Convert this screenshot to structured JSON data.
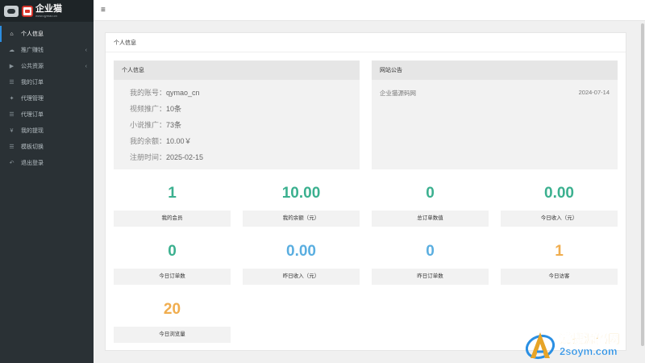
{
  "app": {
    "logo_title": "企业猫",
    "logo_sub": "www.qymao.cn"
  },
  "sidebar": {
    "items": [
      {
        "label": "个人信息",
        "icon": "home-icon",
        "glyph": "⌂",
        "active": true,
        "has_arrow": false
      },
      {
        "label": "推广赚钱",
        "icon": "cloud-icon",
        "glyph": "☁",
        "active": false,
        "has_arrow": true
      },
      {
        "label": "公共资源",
        "icon": "video-icon",
        "glyph": "▶",
        "active": false,
        "has_arrow": true
      },
      {
        "label": "我的订单",
        "icon": "list-icon",
        "glyph": "☰",
        "active": false,
        "has_arrow": false
      },
      {
        "label": "代理管理",
        "icon": "gift-icon",
        "glyph": "✦",
        "active": false,
        "has_arrow": false
      },
      {
        "label": "代理订单",
        "icon": "list-icon",
        "glyph": "☰",
        "active": false,
        "has_arrow": false
      },
      {
        "label": "我的提现",
        "icon": "yen-icon",
        "glyph": "¥",
        "active": false,
        "has_arrow": false
      },
      {
        "label": "模板切换",
        "icon": "list-icon",
        "glyph": "☰",
        "active": false,
        "has_arrow": false
      },
      {
        "label": "退出登录",
        "icon": "reply-icon",
        "glyph": "↶",
        "active": false,
        "has_arrow": false
      }
    ]
  },
  "topbar": {
    "menu_glyph": "≡"
  },
  "panel": {
    "title": "个人信息"
  },
  "profile": {
    "title": "个人信息",
    "rows": [
      {
        "label": "我的账号：",
        "value": "qymao_cn"
      },
      {
        "label": "视频推广：",
        "value": "10条"
      },
      {
        "label": "小说推广：",
        "value": "73条"
      },
      {
        "label": "我的余额：",
        "value": "10.00￥"
      },
      {
        "label": "注册时间：",
        "value": "2025-02-15"
      }
    ]
  },
  "notice": {
    "title": "网站公告",
    "items": [
      {
        "text": "企业猫源码网",
        "date": "2024-07-14"
      }
    ]
  },
  "stats": [
    {
      "value": "1",
      "label": "我的会员",
      "color": "#3bb08f"
    },
    {
      "value": "10.00",
      "label": "我的余额（元）",
      "color": "#3bb08f"
    },
    {
      "value": "0",
      "label": "总订单数值",
      "color": "#3bb08f"
    },
    {
      "value": "0.00",
      "label": "今日收入（元）",
      "color": "#3bb08f"
    },
    {
      "value": "0",
      "label": "今日订单数",
      "color": "#3bb08f"
    },
    {
      "value": "0.00",
      "label": "昨日收入（元）",
      "color": "#5aaee0"
    },
    {
      "value": "0",
      "label": "昨日订单数",
      "color": "#5aaee0"
    },
    {
      "value": "1",
      "label": "今日访客",
      "color": "#f0ad4e"
    },
    {
      "value": "20",
      "label": "今日浏览量",
      "color": "#f0ad4e"
    }
  ],
  "watermark": {
    "cn": "爱搜源码网",
    "en": "2soym.com",
    "colors": {
      "orange": "#e7a427",
      "blue": "#2a8fe3"
    }
  }
}
